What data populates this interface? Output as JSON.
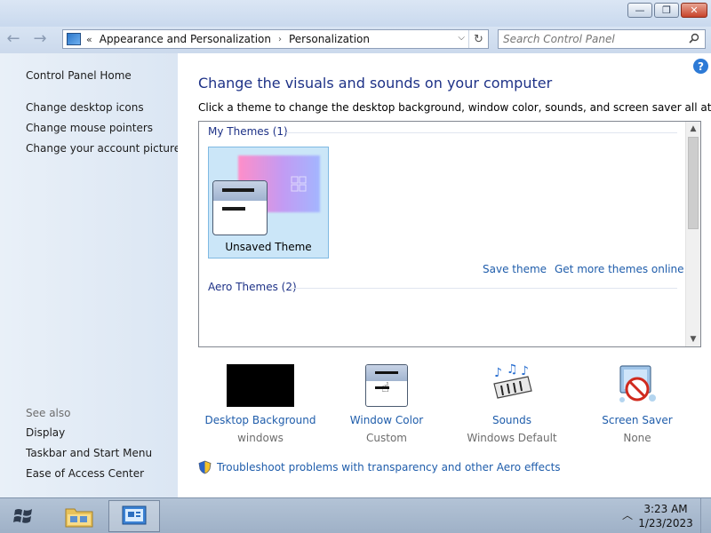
{
  "window": {
    "buttons": {
      "minimize": "—",
      "maximize": "❐",
      "close": "✕"
    }
  },
  "nav": {
    "back": "←",
    "forward": "→",
    "address": {
      "chevrons": "«",
      "crumbs": [
        "Appearance and Personalization",
        "Personalization"
      ],
      "separator": "›",
      "dropdown": "⌵",
      "refresh": "↻"
    },
    "search": {
      "placeholder": "Search Control Panel"
    }
  },
  "sidebar": {
    "home": "Control Panel Home",
    "links": [
      "Change desktop icons",
      "Change mouse pointers",
      "Change your account picture"
    ],
    "see_also_label": "See also",
    "see_also": [
      "Display",
      "Taskbar and Start Menu",
      "Ease of Access Center"
    ]
  },
  "main": {
    "help": "?",
    "title": "Change the visuals and sounds on your computer",
    "subtitle": "Click a theme to change the desktop background, window color, sounds, and screen saver all at once.",
    "my_themes_header": "My Themes (1)",
    "unsaved_theme": "Unsaved Theme",
    "save_theme": "Save theme",
    "get_more": "Get more themes online",
    "aero_header": "Aero Themes (2)",
    "scroll_up": "▲",
    "scroll_down": "▼",
    "settings": [
      {
        "label": "Desktop Background",
        "value": "windows"
      },
      {
        "label": "Window Color",
        "value": "Custom"
      },
      {
        "label": "Sounds",
        "value": "Windows Default"
      },
      {
        "label": "Screen Saver",
        "value": "None"
      }
    ],
    "troubleshoot": "Troubleshoot problems with transparency and other Aero effects"
  },
  "taskbar": {
    "tray_arrow": "︿",
    "time": "3:23 AM",
    "date": "1/23/2023"
  },
  "colors": {
    "link": "#1f5dab",
    "heading": "#1e3287"
  }
}
